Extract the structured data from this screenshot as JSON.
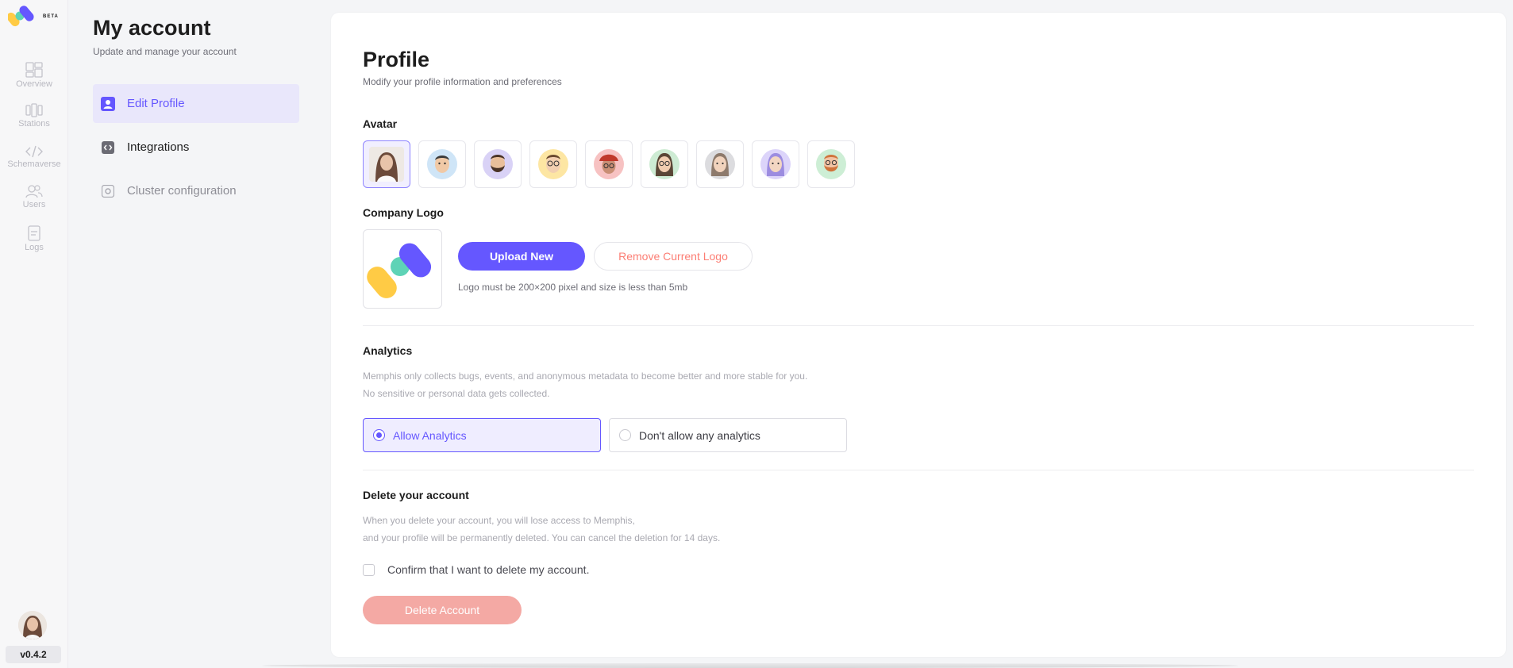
{
  "brand": {
    "badge": "BETA"
  },
  "nav": {
    "items": [
      {
        "label": "Overview",
        "icon": "dashboard-icon"
      },
      {
        "label": "Stations",
        "icon": "stations-icon"
      },
      {
        "label": "Schemaverse",
        "icon": "code-icon"
      },
      {
        "label": "Users",
        "icon": "users-icon"
      },
      {
        "label": "Logs",
        "icon": "logs-icon"
      }
    ],
    "version": "v0.4.2"
  },
  "settings": {
    "title": "My account",
    "subtitle": "Update and manage your account",
    "menu": [
      {
        "label": "Edit Profile",
        "icon": "user-card-icon",
        "active": true
      },
      {
        "label": "Integrations",
        "icon": "integrations-icon",
        "active": false
      },
      {
        "label": "Cluster configuration",
        "icon": "cluster-icon",
        "active": false
      }
    ]
  },
  "profile": {
    "title": "Profile",
    "subtitle": "Modify your profile information and preferences",
    "avatar_label": "Avatar",
    "avatars": [
      {
        "icon": "avatar-photo-woman",
        "selected": true
      },
      {
        "icon": "avatar-man-blue-bg",
        "selected": false
      },
      {
        "icon": "avatar-bearded-man-purple-bg",
        "selected": false
      },
      {
        "icon": "avatar-man-glasses-yellow-bg",
        "selected": false
      },
      {
        "icon": "avatar-woman-hat-red-bg",
        "selected": false
      },
      {
        "icon": "avatar-woman-glasses-green-bg",
        "selected": false
      },
      {
        "icon": "avatar-woman-grey-bg",
        "selected": false
      },
      {
        "icon": "avatar-woman-purple-bg",
        "selected": false
      },
      {
        "icon": "avatar-man-beard-green-bg",
        "selected": false
      }
    ],
    "company_logo_label": "Company Logo",
    "upload_label": "Upload New",
    "remove_label": "Remove Current Logo",
    "logo_hint": "Logo must be 200×200 pixel and size is less than 5mb"
  },
  "analytics": {
    "title": "Analytics",
    "line1": "Memphis only collects bugs, events, and anonymous metadata to become better and more stable for you.",
    "line2": "No sensitive or personal data gets collected.",
    "options": [
      {
        "label": "Allow Analytics",
        "checked": true
      },
      {
        "label": "Don't allow any analytics",
        "checked": false
      }
    ]
  },
  "delete_account": {
    "title": "Delete your account",
    "line1": "When you delete your account, you will lose access to Memphis,",
    "line2": "and your profile will be permanently deleted. You can cancel the deletion for 14 days.",
    "confirm_label": "Confirm that I want to delete my account.",
    "button_label": "Delete Account"
  },
  "colors": {
    "accent": "#6557ff",
    "danger_text": "#fc7e74",
    "danger_button": "#f4a9a4",
    "active_menu_bg": "#e9e7fb",
    "brand_yellow": "#ffcb45",
    "brand_teal": "#5ed3b6",
    "brand_purple": "#6557ff"
  }
}
